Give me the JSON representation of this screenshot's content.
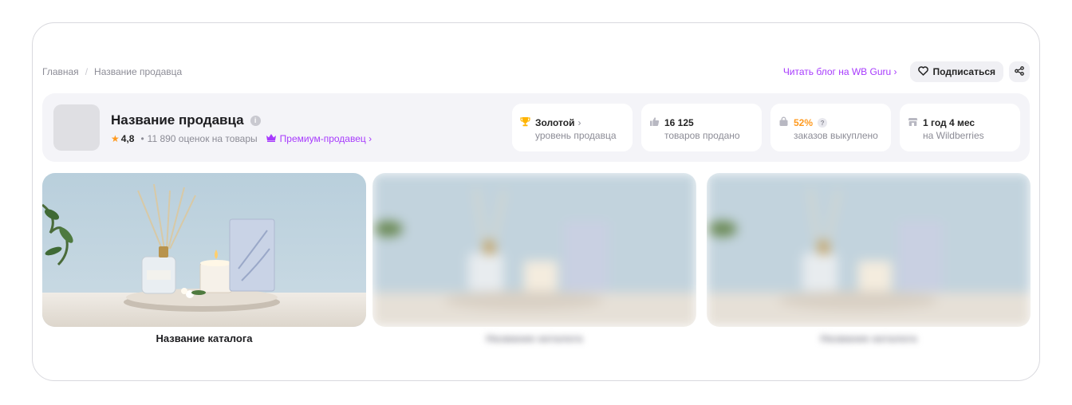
{
  "breadcrumbs": [
    "Главная",
    "Название продавца"
  ],
  "top_actions": {
    "blog_link": "Читать блог на WB Guru ›",
    "subscribe_label": "Подписаться"
  },
  "seller": {
    "name": "Название продавца",
    "rating": "4,8",
    "reviews": "11 890 оценок на товары",
    "premium_label": "Премиум-продавец ›"
  },
  "stats": [
    {
      "icon": "trophy-icon",
      "value": "Золотой",
      "suffix": "›",
      "label": "уровень продавца"
    },
    {
      "icon": "thumb-up-icon",
      "value": "16 125",
      "label": "товаров продано"
    },
    {
      "icon": "bag-icon",
      "value": "52%",
      "label": "заказов выкуплено",
      "value_color": "#ff9a1f"
    },
    {
      "icon": "store-icon",
      "value": "1 год 4 мес",
      "label": "на Wildberries"
    }
  ],
  "catalogs": [
    {
      "title": "Название каталога",
      "blurred": false
    },
    {
      "title": "Название каталога",
      "blurred": true
    },
    {
      "title": "Название каталога",
      "blurred": true
    }
  ],
  "colors": {
    "accent": "#a73afd",
    "star": "#ff9a1f",
    "panel_bg": "#f4f4f8"
  }
}
